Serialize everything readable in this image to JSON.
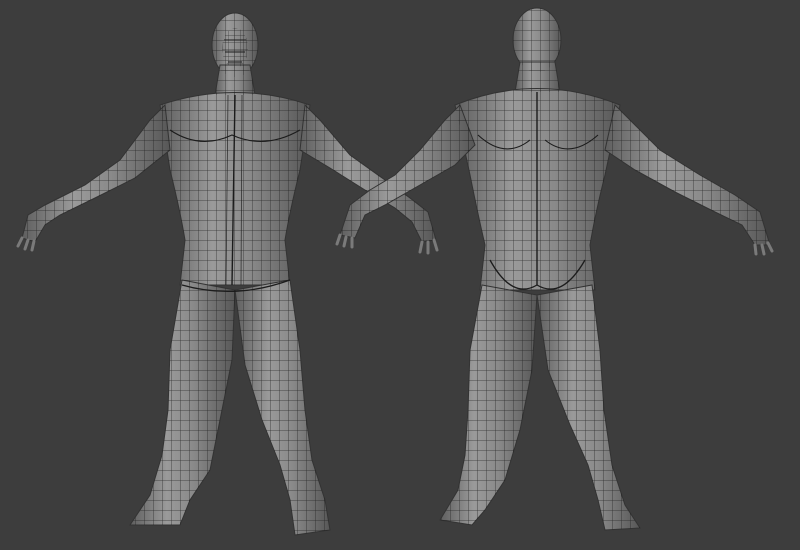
{
  "scene": {
    "background_color": "#3d3d3d",
    "mesh_fill": "#8e8e8e",
    "mesh_shade": "#5a5a5a",
    "mesh_highlight": "#a6a6a6",
    "wire_color": "#1c1c1c"
  },
  "models": [
    {
      "view": "front",
      "icon": "humanoid-mesh-front-icon"
    },
    {
      "view": "back",
      "icon": "humanoid-mesh-back-icon"
    }
  ]
}
